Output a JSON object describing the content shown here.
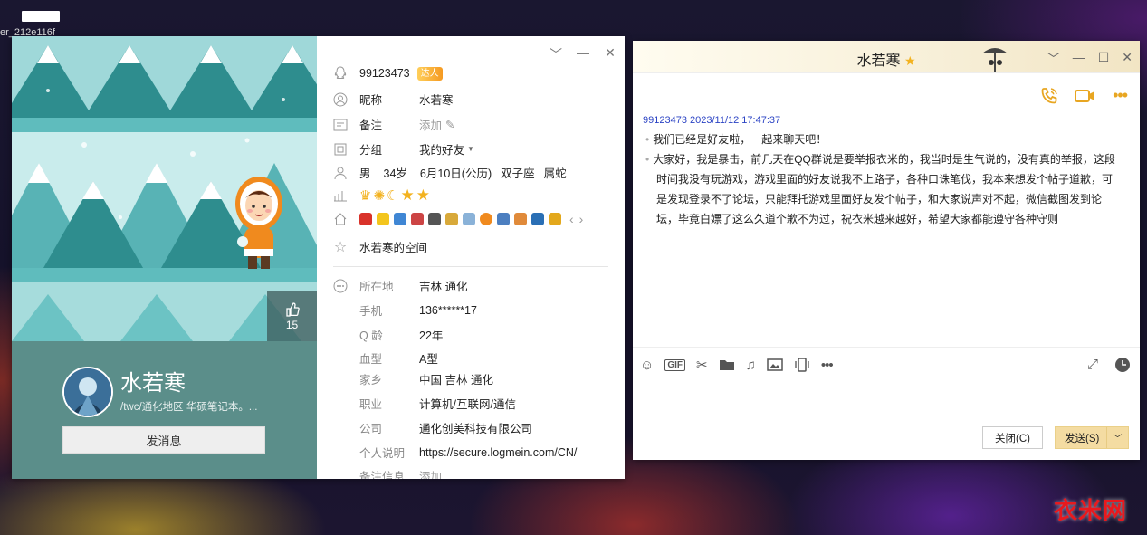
{
  "desktop": {
    "label_text": "er_212e116f",
    "watermark": "衣米网"
  },
  "profile": {
    "qq": "99123473",
    "vip_tag": "达人",
    "fields_top": [
      {
        "icon": "user-circle-icon",
        "label": "昵称",
        "value": "水若寒"
      },
      {
        "icon": "note-icon",
        "label": "备注",
        "value": "添加"
      },
      {
        "icon": "group-icon",
        "label": "分组",
        "value": "我的好友"
      }
    ],
    "basic": {
      "gender": "男",
      "age": "34岁",
      "birthday": "6月10日(公历)",
      "zodiac": "双子座",
      "chinese_zodiac": "属蛇"
    },
    "space_link": "水若寒的空间",
    "like_count": "15",
    "nickname": "水若寒",
    "signature": "/twc/通化地区 华硕笔记本。...",
    "send_message": "发消息",
    "details": [
      {
        "label": "所在地",
        "value": "吉林 通化"
      },
      {
        "label": "手机",
        "value": "136******17"
      },
      {
        "label": "Q 龄",
        "value": "22年"
      },
      {
        "label": "血型",
        "value": "A型"
      },
      {
        "label": "家乡",
        "value": "中国 吉林 通化"
      },
      {
        "label": "职业",
        "value": "计算机/互联网/通信"
      },
      {
        "label": "公司",
        "value": "通化创美科技有限公司"
      },
      {
        "label": "个人说明",
        "value": "https://secure.logmein.com/CN/"
      },
      {
        "label": "备注信息",
        "value": "添加"
      }
    ]
  },
  "chat": {
    "title": "水若寒",
    "meta": "99123473 2023/11/12 17:47:37",
    "messages": [
      "我们已经是好友啦，一起来聊天吧！",
      "大家好，我是暴击，前几天在QQ群说是要举报衣米的，我当时是生气说的，没有真的举报，这段",
      "时间我没有玩游戏，游戏里面的好友说我不上路子，各种口诛笔伐，我本来想发个帖子道歉，可",
      "是发现登录不了论坛，只能拜托游戏里面好友发个帖子，和大家说声对不起，微信截图发到论",
      "坛，毕竟白嫖了这么久道个歉不为过，祝衣米越来越好，希望大家都能遵守各种守则"
    ],
    "close_label": "关闭(C)",
    "send_label": "发送(S)"
  },
  "colors": {
    "cover_bg": "#5c918d",
    "accent": "#e8a622",
    "meta_blue": "#2b43c4",
    "send_bg": "#f4dca2"
  }
}
